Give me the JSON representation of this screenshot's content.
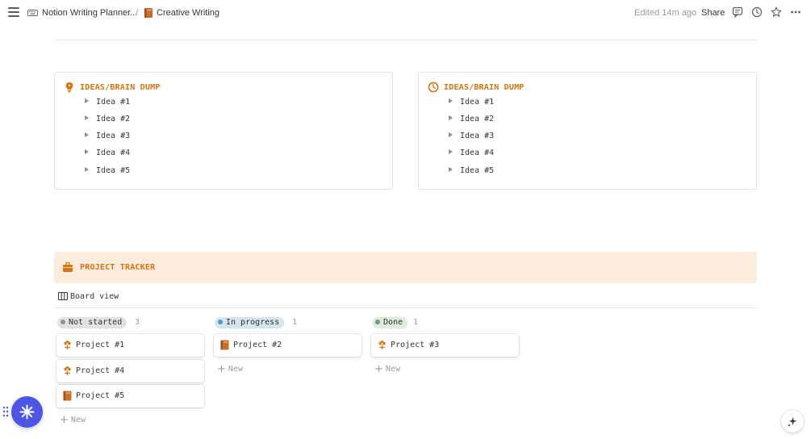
{
  "breadcrumb": {
    "workspace": "Notion Writing Planner...",
    "separator": "/",
    "page": "Creative Writing"
  },
  "topbar": {
    "edited": "Edited 14m ago",
    "share_label": "Share",
    "icons": [
      "comment-icon",
      "history-icon",
      "star-icon",
      "more-icon"
    ]
  },
  "cards": [
    {
      "title": "IDEAS/BRAIN DUMP",
      "icon": "lightbulb-icon",
      "items": [
        "Idea #1",
        "Idea #2",
        "Idea #3",
        "Idea #4",
        "Idea #5"
      ]
    },
    {
      "title": "IDEAS/BRAIN DUMP",
      "icon": "clock-icon",
      "items": [
        "Idea #1",
        "Idea #2",
        "Idea #3",
        "Idea #4",
        "Idea #5"
      ]
    }
  ],
  "tracker": {
    "title": "PROJECT TRACKER",
    "icon": "briefcase-icon",
    "view_label": "Board view"
  },
  "board": {
    "columns": [
      {
        "status": "Not started",
        "count": "3",
        "dot_color": "#91918e",
        "pill_color": "#e3e2e0",
        "cards": [
          {
            "label": "Project #1",
            "icon": "flower-icon"
          },
          {
            "label": "Project #4",
            "icon": "flower-icon"
          },
          {
            "label": "Project #5",
            "icon": "book-icon"
          }
        ],
        "new_label": "New"
      },
      {
        "status": "In progress",
        "count": "1",
        "dot_color": "#5b97bd",
        "pill_color": "#d3e5ef",
        "cards": [
          {
            "label": "Project #2",
            "icon": "book-icon"
          }
        ],
        "new_label": "New"
      },
      {
        "status": "Done",
        "count": "1",
        "dot_color": "#6c9b7d",
        "pill_color": "#dbeddb",
        "cards": [
          {
            "label": "Project #3",
            "icon": "flower-icon"
          }
        ],
        "new_label": "New"
      }
    ]
  },
  "colors": {
    "accent": "#d9730d",
    "tracker_bg": "#fbecdd",
    "fab": "#4d55e6"
  }
}
